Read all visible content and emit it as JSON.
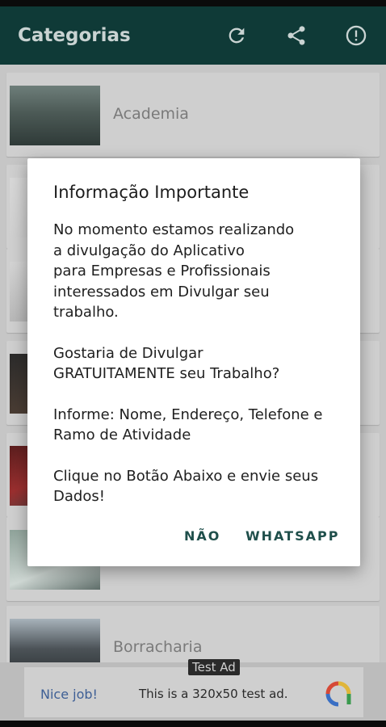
{
  "appbar": {
    "title": "Categorias",
    "icons": [
      "refresh-icon",
      "share-icon",
      "info-icon"
    ],
    "color": "#0f3a37"
  },
  "list": {
    "items": [
      {
        "label": "Academia"
      },
      {
        "label": ""
      },
      {
        "label": ""
      },
      {
        "label": ""
      },
      {
        "label": ""
      },
      {
        "label": ""
      },
      {
        "label": "Borracharia"
      }
    ]
  },
  "dialog": {
    "title": "Informação Importante",
    "paragraphs": [
      "No momento estamos realizando\na divulgação do Aplicativo\npara Empresas e Profissionais\ninteressados em Divulgar seu\ntrabalho.",
      "Gostaria de Divulgar\nGRATUITAMENTE seu Trabalho?",
      "Informe: Nome, Endereço, Telefone e\nRamo de Atividade",
      "Clique no Botão Abaixo e envie seus\nDados!"
    ],
    "buttons": {
      "negative": "NÃO",
      "positive": "WHATSAPP"
    },
    "button_color": "#1f4f4b"
  },
  "ad": {
    "badge": "Test Ad",
    "nice": "Nice job!",
    "text": "This is a 320x50 test ad."
  }
}
